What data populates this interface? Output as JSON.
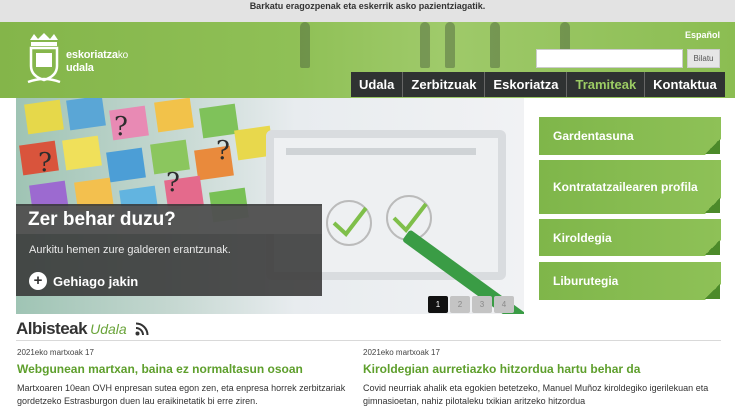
{
  "notice": "Barkatu eragozpenak eta eskerrik asko pazientziagatik.",
  "brand": {
    "name": "eskoriatza",
    "suffix": "ko",
    "line2": "udala"
  },
  "language": "Español",
  "search": {
    "value": "",
    "button": "Bilatu"
  },
  "nav": [
    {
      "label": "Udala",
      "active": false
    },
    {
      "label": "Zerbitzuak",
      "active": false
    },
    {
      "label": "Eskoriatza",
      "active": false
    },
    {
      "label": "Tramiteak",
      "active": true
    },
    {
      "label": "Kontaktua",
      "active": false
    }
  ],
  "hero": {
    "title": "Zer behar duzu?",
    "text": "Aurkitu hemen zure galderen erantzunak.",
    "more": "Gehiago jakin"
  },
  "pager": [
    "1",
    "2",
    "3",
    "4"
  ],
  "side": [
    {
      "label": "Gardentasuna"
    },
    {
      "label": "Kontratatzailearen profila"
    },
    {
      "label": "Kiroldegia"
    },
    {
      "label": "Liburutegia"
    }
  ],
  "news": {
    "title": "Albisteak",
    "subtitle": "Udala",
    "articles": [
      {
        "date": "2021eko martxoak 17",
        "headline": "Webgunean martxan, baina ez normaltasun osoan",
        "body": "Martxoaren 10ean OVH enpresan sutea egon zen, eta enpresa horrek zerbitzariak gordetzeko Estrasburgon duen lau eraikinetatik bi erre ziren."
      },
      {
        "date": "2021eko martxoak 17",
        "headline": "Kiroldegian aurretiazko hitzordua hartu behar da",
        "body": "Covid neurriak ahalik eta egokien betetzeko, Manuel Muñoz kiroldegiko igerilekuan eta gimnasioetan, nahiz pilotaleku txikian aritzeko hitzordua"
      }
    ]
  },
  "colors": {
    "brand_green": "#84b54a",
    "nav_bg": "#2f3232",
    "headline_green": "#5e9f2c"
  }
}
